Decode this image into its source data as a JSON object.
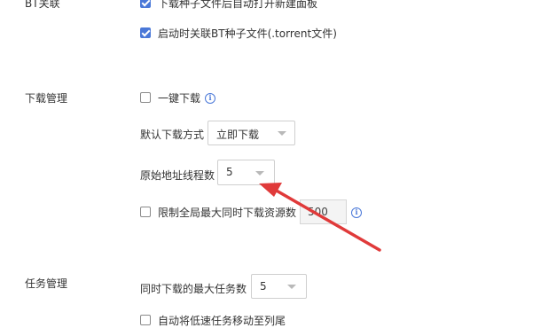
{
  "sections": {
    "bt": {
      "label": "BT关联",
      "options": [
        {
          "label": "下载种子文件后自动打开新建面板",
          "checked": true
        },
        {
          "label": "启动时关联BT种子文件(.torrent文件)",
          "checked": true
        }
      ]
    },
    "download": {
      "label": "下载管理",
      "one_click": {
        "label": "一键下载",
        "checked": false,
        "info_icon": "info-icon"
      },
      "default_mode": {
        "label": "默认下载方式",
        "value": "立即下载"
      },
      "origin_threads": {
        "label": "原始地址线程数",
        "value": "5"
      },
      "limit_sources": {
        "label": "限制全局最大同时下载资源数",
        "checked": false,
        "value": "500",
        "info_icon": "info-icon"
      }
    },
    "tasks": {
      "label": "任务管理",
      "max_tasks": {
        "label": "同时下载的最大任务数",
        "value": "5"
      },
      "partial_text": "自动将低速任务移动至列尾"
    }
  },
  "annotation": {
    "color": "#e03a3a",
    "icon": "red-arrow-icon"
  },
  "colors": {
    "accent": "#4a78d8",
    "checkbox_border": "#8a8a8a"
  }
}
